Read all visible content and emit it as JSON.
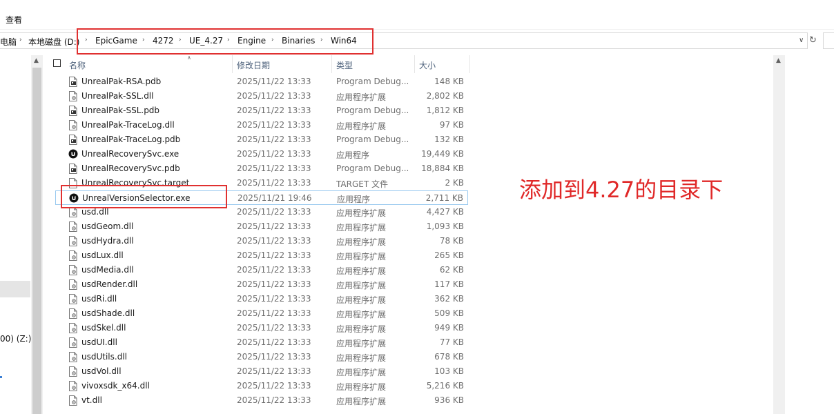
{
  "menu": {
    "view": "查看"
  },
  "address": {
    "segments": [
      "电脑",
      "本地磁盘 (D:)",
      "EpicGame",
      "4272",
      "UE_4.27",
      "Engine",
      "Binaries",
      "Win64"
    ]
  },
  "nav": {
    "drive_z": "00) (Z:)"
  },
  "columns": {
    "name": "名称",
    "date": "修改日期",
    "type": "类型",
    "size": "大小"
  },
  "files": [
    {
      "name": "UnrealPak-RSA.pdb",
      "date": "2025/11/22 13:33",
      "type": "Program Debug...",
      "size": "148 KB",
      "icon": "pdb-file-icon"
    },
    {
      "name": "UnrealPak-SSL.dll",
      "date": "2025/11/22 13:33",
      "type": "应用程序扩展",
      "size": "2,802 KB",
      "icon": "dll-file-icon"
    },
    {
      "name": "UnrealPak-SSL.pdb",
      "date": "2025/11/22 13:33",
      "type": "Program Debug...",
      "size": "1,812 KB",
      "icon": "pdb-file-icon"
    },
    {
      "name": "UnrealPak-TraceLog.dll",
      "date": "2025/11/22 13:33",
      "type": "应用程序扩展",
      "size": "97 KB",
      "icon": "dll-file-icon"
    },
    {
      "name": "UnrealPak-TraceLog.pdb",
      "date": "2025/11/22 13:33",
      "type": "Program Debug...",
      "size": "132 KB",
      "icon": "pdb-file-icon"
    },
    {
      "name": "UnrealRecoverySvc.exe",
      "date": "2025/11/22 13:33",
      "type": "应用程序",
      "size": "19,449 KB",
      "icon": "unreal-exe-icon"
    },
    {
      "name": "UnrealRecoverySvc.pdb",
      "date": "2025/11/22 13:33",
      "type": "Program Debug...",
      "size": "18,884 KB",
      "icon": "pdb-file-icon"
    },
    {
      "name": "UnrealRecoverySvc.target",
      "date": "2025/11/22 13:33",
      "type": "TARGET 文件",
      "size": "2 KB",
      "icon": "generic-file-icon"
    },
    {
      "name": "UnrealVersionSelector.exe",
      "date": "2025/11/21 19:46",
      "type": "应用程序",
      "size": "2,711 KB",
      "icon": "unreal-exe-icon"
    },
    {
      "name": "usd.dll",
      "date": "2025/11/22 13:33",
      "type": "应用程序扩展",
      "size": "4,427 KB",
      "icon": "dll-file-icon"
    },
    {
      "name": "usdGeom.dll",
      "date": "2025/11/22 13:33",
      "type": "应用程序扩展",
      "size": "1,093 KB",
      "icon": "dll-file-icon"
    },
    {
      "name": "usdHydra.dll",
      "date": "2025/11/22 13:33",
      "type": "应用程序扩展",
      "size": "78 KB",
      "icon": "dll-file-icon"
    },
    {
      "name": "usdLux.dll",
      "date": "2025/11/22 13:33",
      "type": "应用程序扩展",
      "size": "265 KB",
      "icon": "dll-file-icon"
    },
    {
      "name": "usdMedia.dll",
      "date": "2025/11/22 13:33",
      "type": "应用程序扩展",
      "size": "62 KB",
      "icon": "dll-file-icon"
    },
    {
      "name": "usdRender.dll",
      "date": "2025/11/22 13:33",
      "type": "应用程序扩展",
      "size": "117 KB",
      "icon": "dll-file-icon"
    },
    {
      "name": "usdRi.dll",
      "date": "2025/11/22 13:33",
      "type": "应用程序扩展",
      "size": "362 KB",
      "icon": "dll-file-icon"
    },
    {
      "name": "usdShade.dll",
      "date": "2025/11/22 13:33",
      "type": "应用程序扩展",
      "size": "509 KB",
      "icon": "dll-file-icon"
    },
    {
      "name": "usdSkel.dll",
      "date": "2025/11/22 13:33",
      "type": "应用程序扩展",
      "size": "949 KB",
      "icon": "dll-file-icon"
    },
    {
      "name": "usdUI.dll",
      "date": "2025/11/22 13:33",
      "type": "应用程序扩展",
      "size": "77 KB",
      "icon": "dll-file-icon"
    },
    {
      "name": "usdUtils.dll",
      "date": "2025/11/22 13:33",
      "type": "应用程序扩展",
      "size": "678 KB",
      "icon": "dll-file-icon"
    },
    {
      "name": "usdVol.dll",
      "date": "2025/11/22 13:33",
      "type": "应用程序扩展",
      "size": "103 KB",
      "icon": "dll-file-icon"
    },
    {
      "name": "vivoxsdk_x64.dll",
      "date": "2025/11/22 13:33",
      "type": "应用程序扩展",
      "size": "5,216 KB",
      "icon": "dll-file-icon"
    },
    {
      "name": "vt.dll",
      "date": "2025/11/22 13:33",
      "type": "应用程序扩展",
      "size": "936 KB",
      "icon": "dll-file-icon"
    }
  ],
  "annotation": "添加到4.27的目录下",
  "colors": {
    "highlight_box": "#e03030",
    "annotation": "#e02828",
    "selection_border": "#99c9ef"
  }
}
